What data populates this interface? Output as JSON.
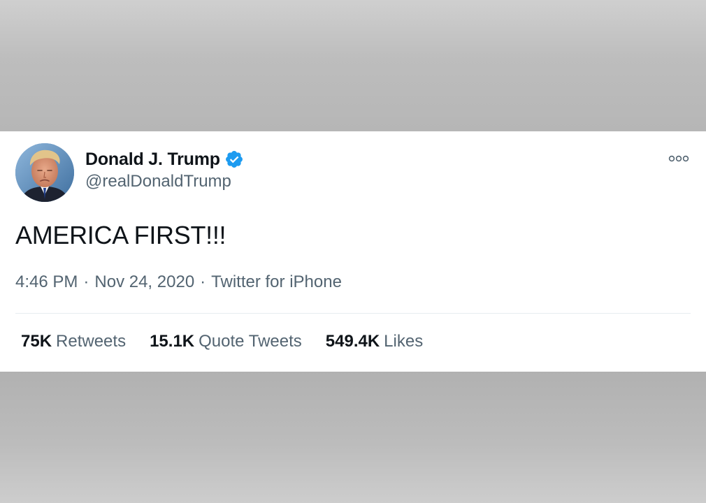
{
  "tweet": {
    "author": {
      "display_name": "Donald J. Trump",
      "username": "@realDonaldTrump",
      "verified": true,
      "verified_badge_color": "#1d9bf0"
    },
    "text": "AMERICA FIRST!!!",
    "meta": {
      "time": "4:46 PM",
      "date": "Nov 24, 2020",
      "source": "Twitter for iPhone",
      "separator": "·"
    },
    "stats": {
      "retweets": {
        "count": "75K",
        "label": "Retweets"
      },
      "quote_tweets": {
        "count": "15.1K",
        "label": "Quote Tweets"
      },
      "likes": {
        "count": "549.4K",
        "label": "Likes"
      }
    },
    "more_icon": "more-options-icon"
  },
  "colors": {
    "primary_text": "#0f1419",
    "secondary_text": "#536471",
    "divider": "#e6ecf0",
    "card_background": "#ffffff"
  }
}
